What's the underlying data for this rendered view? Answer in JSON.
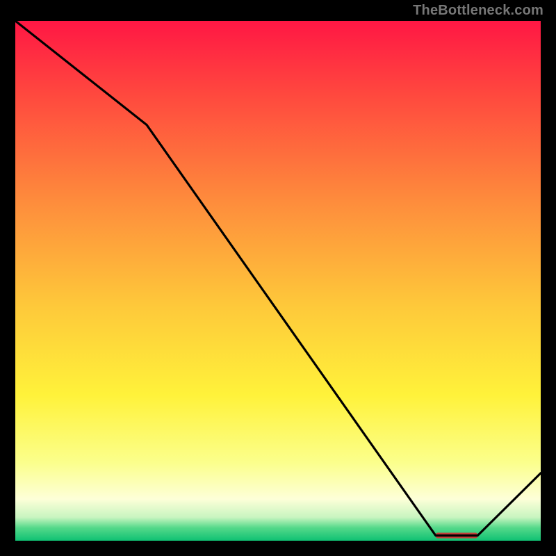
{
  "watermark": "TheBottleneck.com",
  "chart_data": {
    "type": "line",
    "title": "",
    "xlabel": "",
    "ylabel": "",
    "xlim": [
      0,
      100
    ],
    "ylim": [
      0,
      100
    ],
    "x": [
      0,
      25,
      80,
      88,
      100
    ],
    "values": [
      100,
      80,
      1,
      1,
      13
    ],
    "annotation_band": {
      "x_start": 80,
      "x_end": 88,
      "y": 1,
      "color": "#c43f3a"
    },
    "background_gradient": {
      "stops": [
        {
          "offset": 0.0,
          "color": "#ff1744"
        },
        {
          "offset": 0.15,
          "color": "#ff4b3e"
        },
        {
          "offset": 0.35,
          "color": "#fe8d3c"
        },
        {
          "offset": 0.55,
          "color": "#fec93a"
        },
        {
          "offset": 0.72,
          "color": "#fff23a"
        },
        {
          "offset": 0.85,
          "color": "#fbff8c"
        },
        {
          "offset": 0.92,
          "color": "#fdffd8"
        },
        {
          "offset": 0.955,
          "color": "#c8f5c0"
        },
        {
          "offset": 0.975,
          "color": "#55d98a"
        },
        {
          "offset": 1.0,
          "color": "#0fc173"
        }
      ]
    }
  }
}
